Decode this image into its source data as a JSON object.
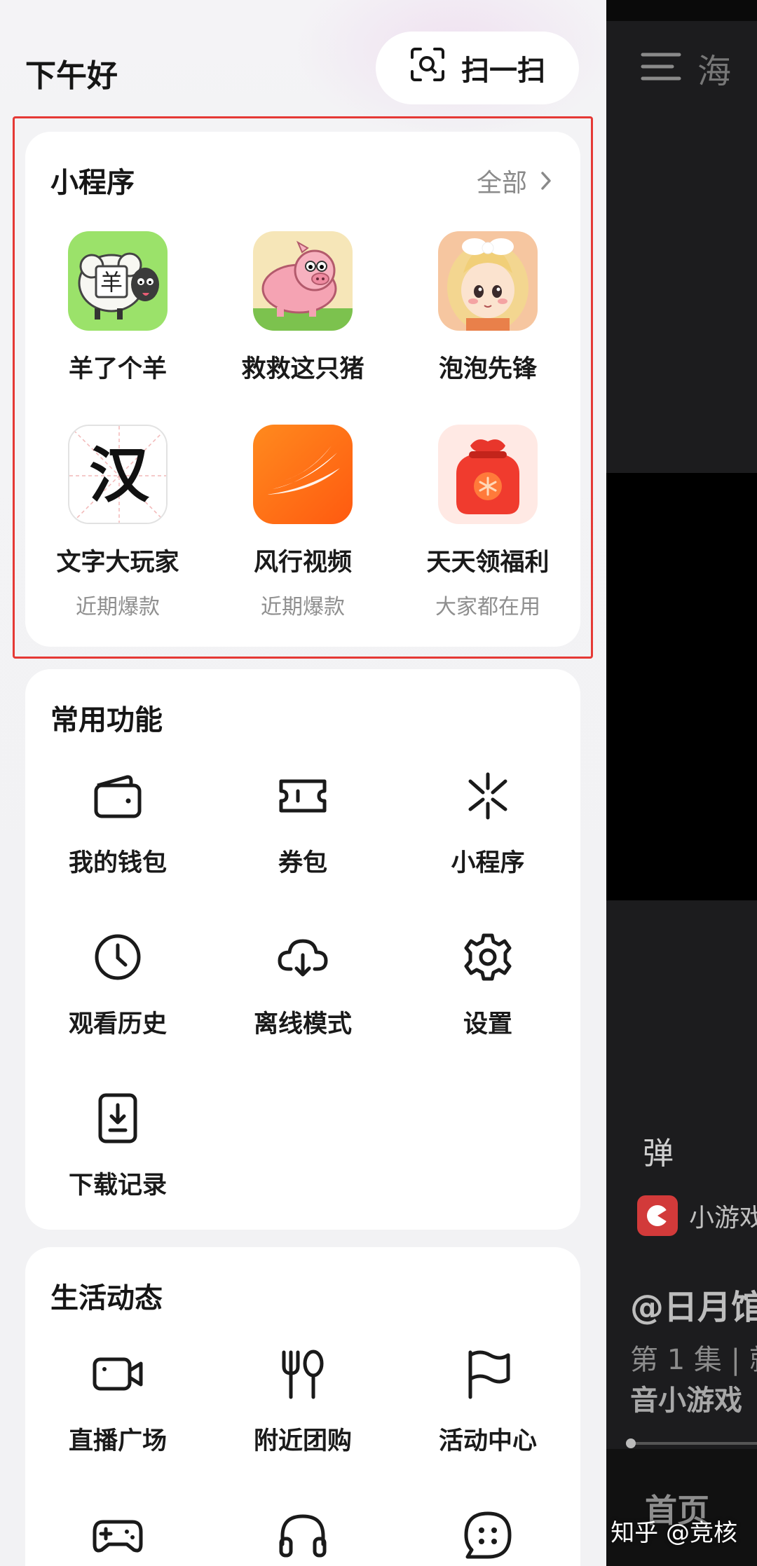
{
  "drawer": {
    "greeting": "下午好",
    "scan_label": "扫一扫"
  },
  "mini_programs": {
    "title": "小程序",
    "more_label": "全部",
    "items": [
      {
        "name": "羊了个羊",
        "sub": "",
        "icon": "sheep-game-icon"
      },
      {
        "name": "救救这只猪",
        "sub": "",
        "icon": "pig-game-icon"
      },
      {
        "name": "泡泡先锋",
        "sub": "",
        "icon": "bubble-girl-icon"
      },
      {
        "name": "文字大玩家",
        "sub": "近期爆款",
        "icon": "han-character-icon"
      },
      {
        "name": "风行视频",
        "sub": "近期爆款",
        "icon": "funshion-video-icon"
      },
      {
        "name": "天天领福利",
        "sub": "大家都在用",
        "icon": "red-packet-icon"
      }
    ],
    "icon_glyph_han": "汉",
    "icon_glyph_sheep": "羊"
  },
  "common_functions": {
    "title": "常用功能",
    "items": [
      {
        "name": "我的钱包",
        "icon": "wallet-icon"
      },
      {
        "name": "券包",
        "icon": "ticket-icon"
      },
      {
        "name": "小程序",
        "icon": "mini-program-icon"
      },
      {
        "name": "观看历史",
        "icon": "clock-icon"
      },
      {
        "name": "离线模式",
        "icon": "cloud-download-icon"
      },
      {
        "name": "设置",
        "icon": "gear-icon"
      },
      {
        "name": "下载记录",
        "icon": "download-file-icon"
      }
    ]
  },
  "life_activity": {
    "title": "生活动态",
    "items": [
      {
        "name": "直播广场",
        "icon": "video-camera-icon"
      },
      {
        "name": "附近团购",
        "icon": "fork-spoon-icon"
      },
      {
        "name": "活动中心",
        "icon": "flag-icon"
      },
      {
        "name": "",
        "icon": "gamepad-icon"
      },
      {
        "name": "",
        "icon": "headphones-icon"
      },
      {
        "name": "",
        "icon": "chat-dots-icon"
      }
    ]
  },
  "background_app": {
    "title_partial": "海",
    "danmaku_partial": "弹",
    "game_label": "小游戏",
    "user_handle": "@日月馆",
    "episode": "第 1 集 | 就",
    "tag": "音小游戏",
    "home_tab": "首页"
  },
  "watermark": "知乎 @竞核",
  "colors": {
    "highlight_border": "#e53935",
    "card_bg": "#ffffff",
    "drawer_bg": "#f2f2f4",
    "orange_accent": "#ff6a13",
    "red_packet": "#e8362c"
  }
}
